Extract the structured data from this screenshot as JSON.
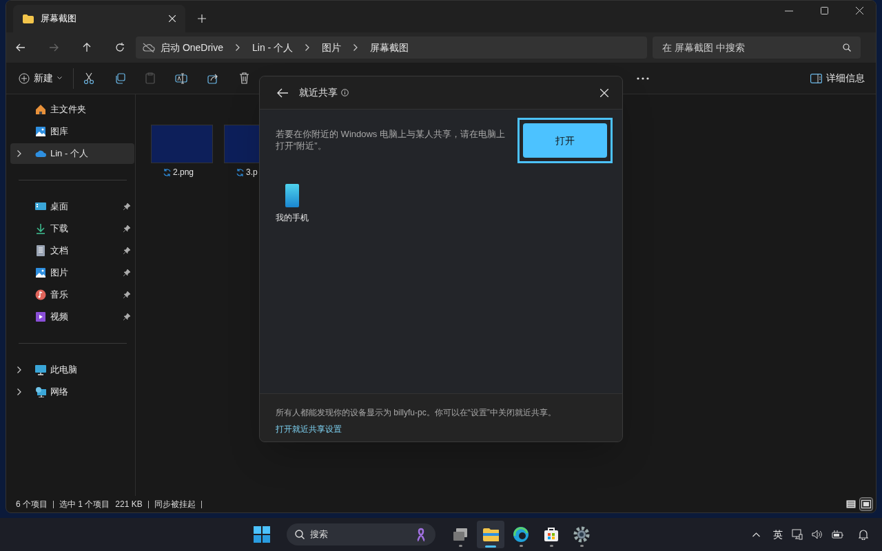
{
  "tabs": [
    {
      "label": "屏幕截图",
      "selected": true
    }
  ],
  "address": {
    "breadcrumbs": [
      "启动 OneDrive",
      "Lin - 个人",
      "图片",
      "屏幕截图"
    ]
  },
  "search": {
    "placeholder": "在 屏幕截图 中搜索"
  },
  "toolbar": {
    "new_label": "新建",
    "details_label": "详细信息"
  },
  "sidebar": {
    "groups": [
      [
        {
          "label": "主文件夹",
          "kind": "home",
          "expandable": false,
          "pinned": false,
          "selected": false
        },
        {
          "label": "图库",
          "kind": "gallery",
          "expandable": false,
          "pinned": false,
          "selected": false
        },
        {
          "label": "Lin - 个人",
          "kind": "cloud",
          "expandable": true,
          "pinned": false,
          "selected": true
        }
      ],
      [
        {
          "label": "桌面",
          "kind": "desktop",
          "expandable": false,
          "pinned": true,
          "selected": false
        },
        {
          "label": "下载",
          "kind": "download",
          "expandable": false,
          "pinned": true,
          "selected": false
        },
        {
          "label": "文档",
          "kind": "document",
          "expandable": false,
          "pinned": true,
          "selected": false
        },
        {
          "label": "图片",
          "kind": "gallery",
          "expandable": false,
          "pinned": true,
          "selected": false
        },
        {
          "label": "音乐",
          "kind": "music",
          "expandable": false,
          "pinned": true,
          "selected": false
        },
        {
          "label": "视频",
          "kind": "video",
          "expandable": false,
          "pinned": true,
          "selected": false
        }
      ],
      [
        {
          "label": "此电脑",
          "kind": "pc",
          "expandable": true,
          "pinned": false,
          "selected": false
        },
        {
          "label": "网络",
          "kind": "network",
          "expandable": true,
          "pinned": false,
          "selected": false
        }
      ]
    ]
  },
  "files": [
    {
      "name": "2.png"
    },
    {
      "name": "3.p"
    }
  ],
  "dialog": {
    "title": "就近共享",
    "message": "若要在你附近的 Windows 电脑上与某人共享，请在电脑上打开“附近”。",
    "button": "打开",
    "devices": [
      {
        "name": "我的手机"
      }
    ],
    "footer": "所有人都能发现你的设备显示为 billyfu-pc。你可以在“设置”中关闭就近共享。",
    "footer_link": "打开就近共享设置"
  },
  "status_bar": [
    "6 个项目",
    "选中 1 个项目",
    "221 KB",
    "同步被挂起"
  ],
  "view_modes": [
    {
      "kind": "details",
      "selected": false
    },
    {
      "kind": "tiles",
      "selected": true
    }
  ],
  "taskbar": {
    "search_placeholder": "搜索",
    "apps": [
      {
        "kind": "taskview",
        "selected": false
      },
      {
        "kind": "explorer",
        "selected": true
      },
      {
        "kind": "edge",
        "selected": false
      },
      {
        "kind": "store",
        "selected": false
      },
      {
        "kind": "settings",
        "selected": false
      }
    ],
    "ime": "英"
  }
}
